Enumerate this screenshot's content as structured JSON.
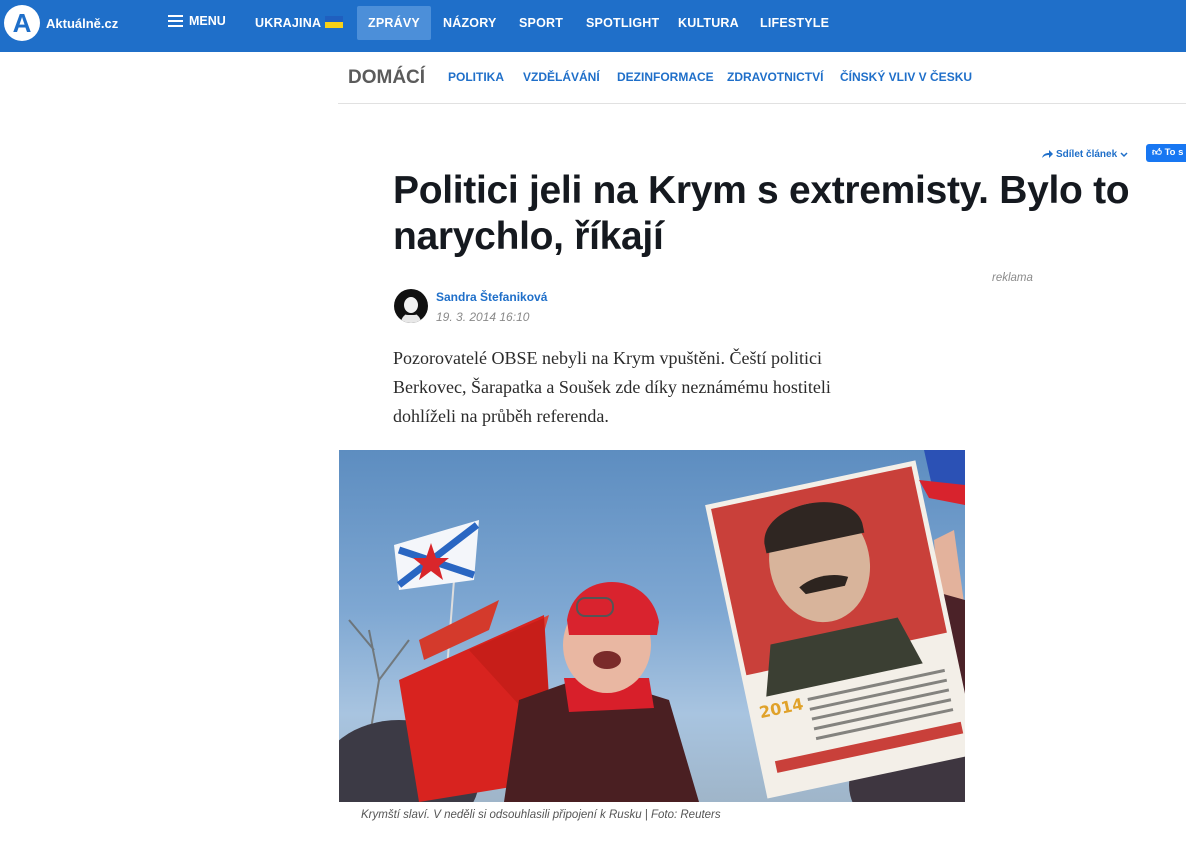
{
  "site": {
    "logo_letter": "A",
    "logo_text": "Aktuálně.cz"
  },
  "topnav": {
    "menu_label": "MENU",
    "items": [
      {
        "label": "UKRAJINA",
        "flag": "ukraine-flag"
      },
      {
        "label": "ZPRÁVY",
        "active": true
      },
      {
        "label": "NÁZORY"
      },
      {
        "label": "SPORT"
      },
      {
        "label": "SPOTLIGHT"
      },
      {
        "label": "KULTURA"
      },
      {
        "label": "LIFESTYLE"
      }
    ]
  },
  "subnav": {
    "section": "DOMÁCÍ",
    "items": [
      "POLITIKA",
      "VZDĚLÁVÁNÍ",
      "DEZINFORMACE",
      "ZDRAVOTNICTVÍ",
      "ČÍNSKÝ VLIV V ČESKU"
    ]
  },
  "share": {
    "label": "Sdílet článek",
    "fb_label": "To s"
  },
  "article": {
    "headline": "Politici jeli na Krym s extremisty. Bylo to narychlo, říkají",
    "ad_label": "reklama",
    "author": "Sandra Štefaniková",
    "date": "19. 3. 2014 16:10",
    "perex": "Pozorovatelé OBSE nebyli na Krym vpuštěni. Čeští politici Berkovec, Šarapatka a Soušek zde díky neznámému hostiteli dohlíželi na průběh referenda.",
    "photo_caption": "Krymští slaví. V neděli si odsouhlasili připojení k Rusku | Foto: Reuters",
    "photo_poster_year": "2014"
  },
  "colors": {
    "brand_blue": "#1f6fc9",
    "active_tab": "#4c8fd9"
  }
}
